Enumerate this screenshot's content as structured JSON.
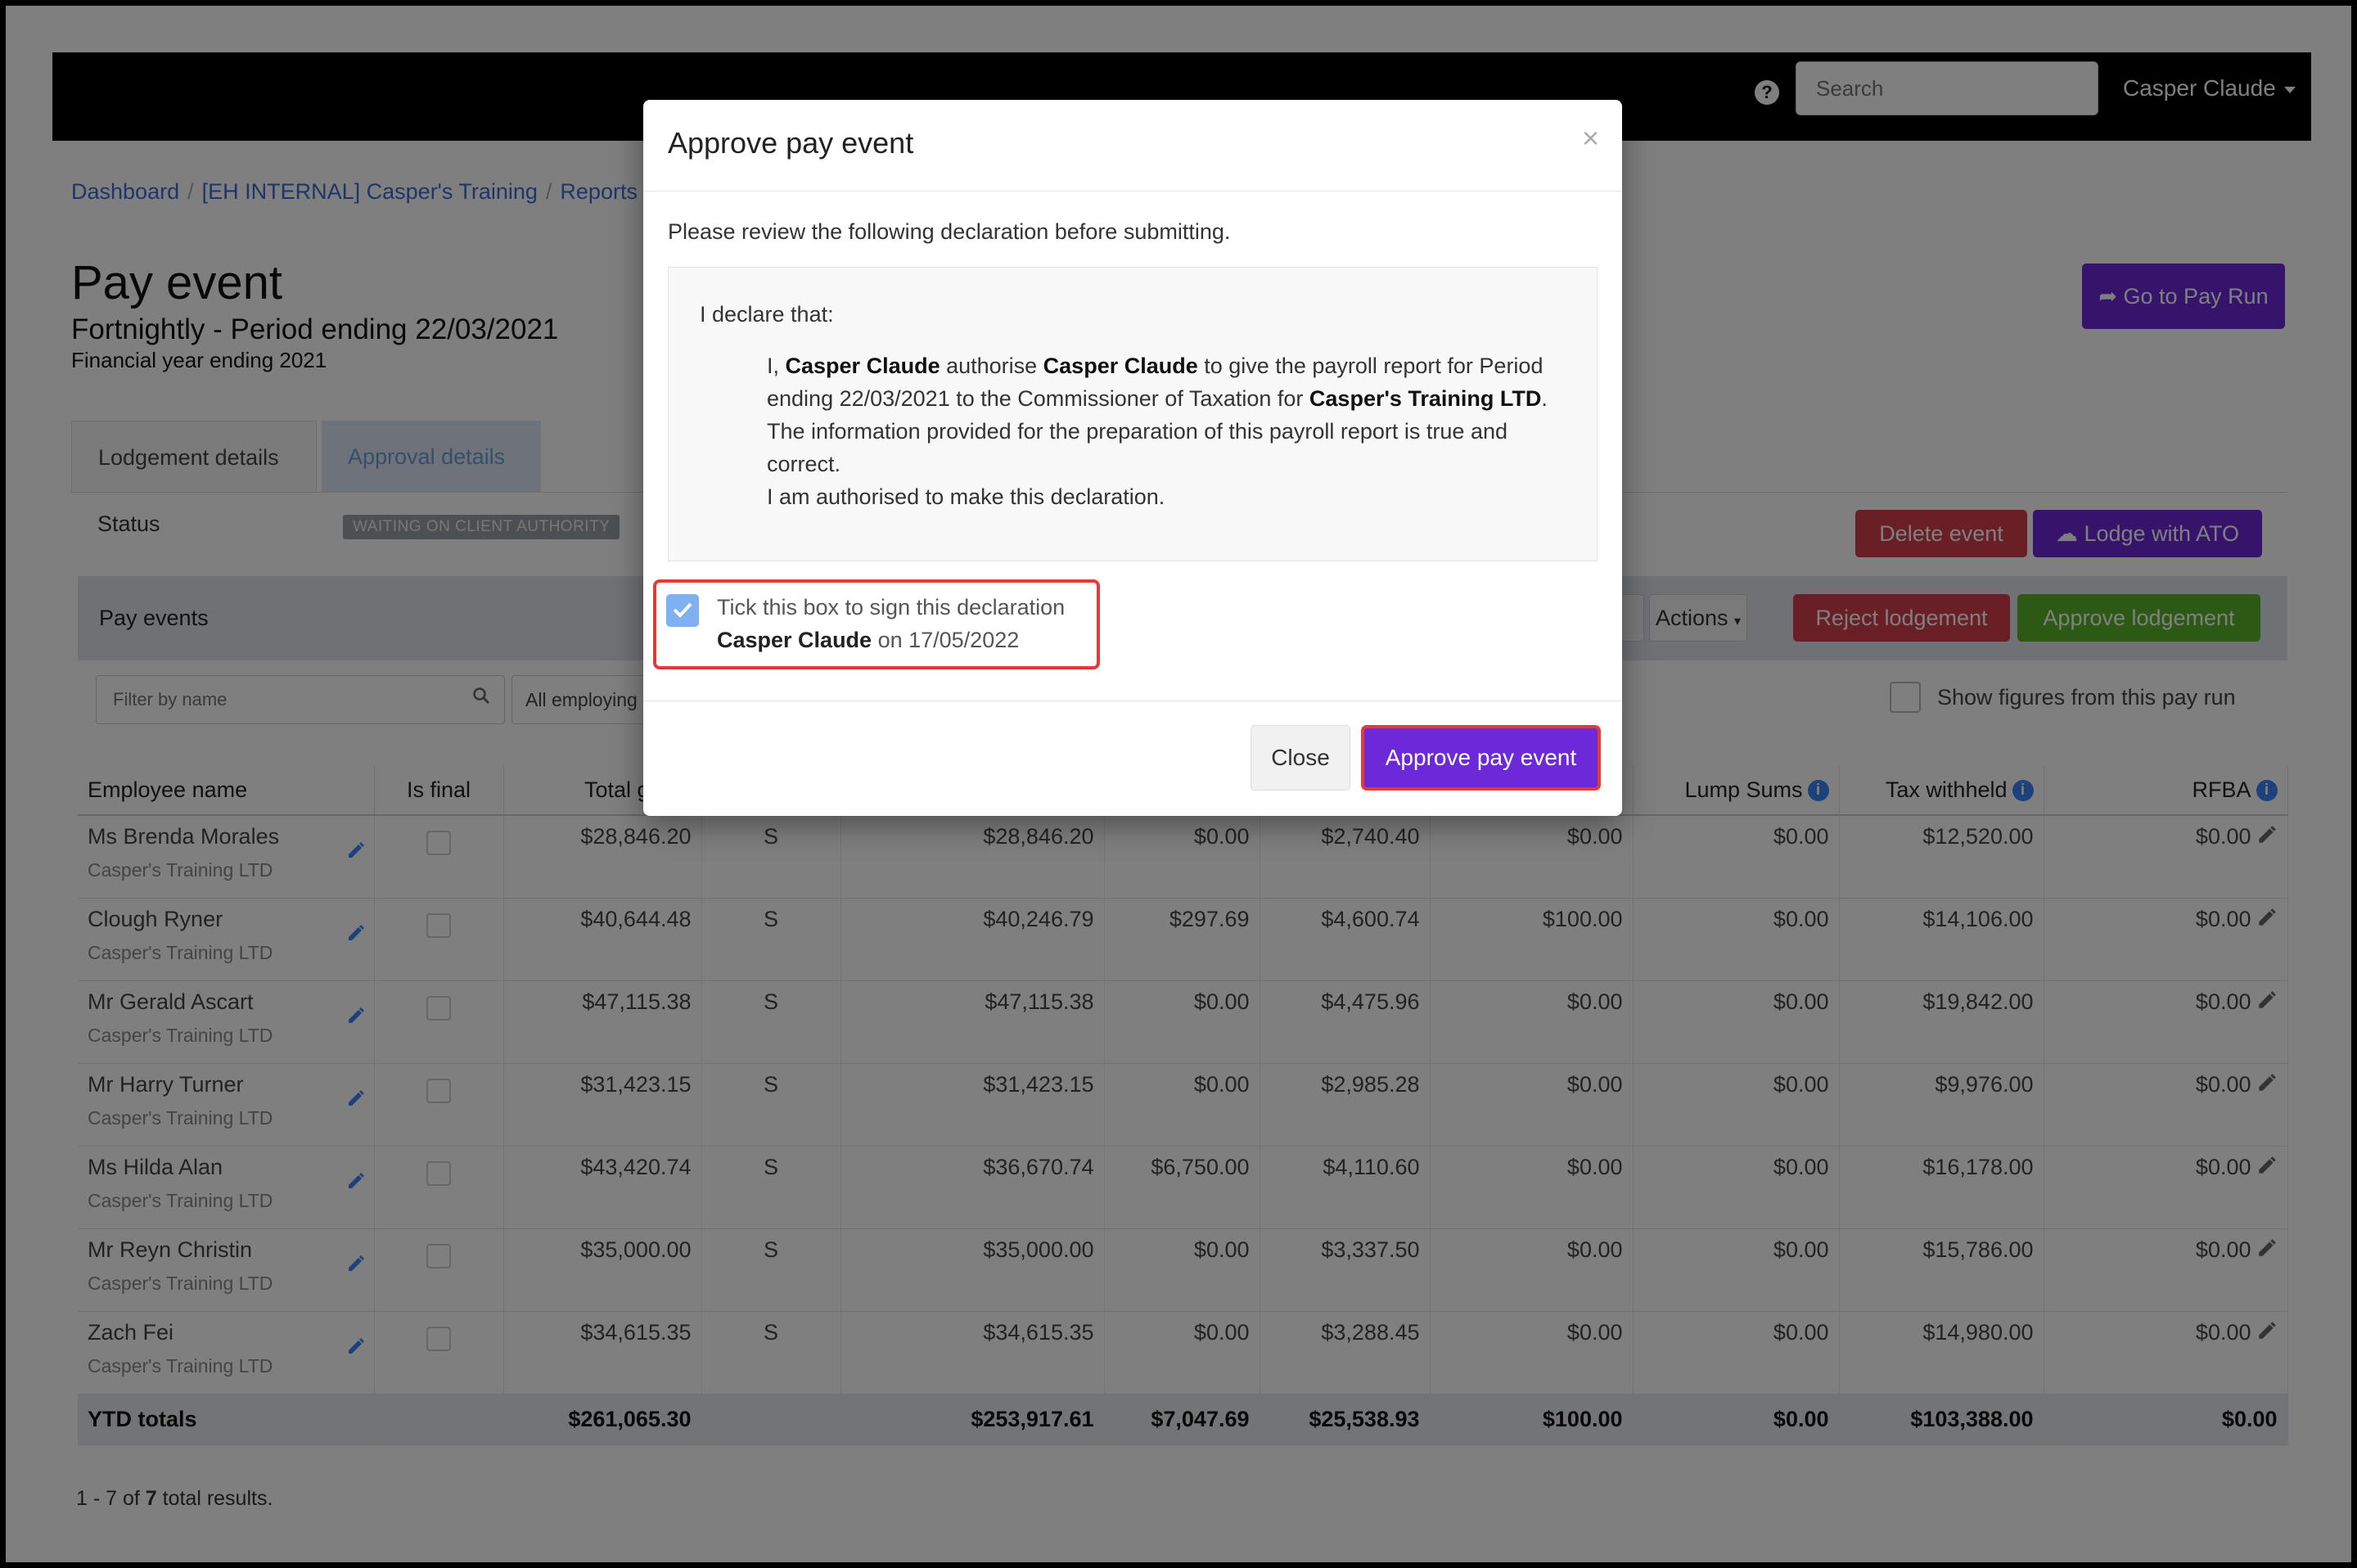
{
  "navbar": {
    "help_glyph": "?",
    "search_placeholder": "Search",
    "user_name": "Casper Claude"
  },
  "breadcrumb": [
    "Dashboard",
    "[EH INTERNAL] Casper's Training",
    "Reports"
  ],
  "header": {
    "title": "Pay event",
    "subtitle": "Fortnightly - Period ending 22/03/2021",
    "financial_year": "Financial year ending 2021",
    "go_to_pay_run": "Go to Pay Run"
  },
  "tabs": [
    {
      "label": "Lodgement details",
      "active": true
    },
    {
      "label": "Approval details",
      "active": false
    }
  ],
  "status": {
    "label": "Status",
    "badge": "WAITING ON CLIENT AUTHORITY"
  },
  "actions_top": {
    "delete": "Delete event",
    "lodge": "Lodge with ATO"
  },
  "pay_events": {
    "title": "Pay events",
    "actions": "Actions",
    "reject": "Reject lodgement",
    "approve": "Approve lodgement",
    "filter_placeholder": "Filter by name",
    "employing_select": "All employing entities",
    "show_figures": "Show figures from this pay run"
  },
  "table": {
    "headers": [
      "Employee name",
      "Is final",
      "Total gross",
      "",
      "",
      "",
      "",
      "",
      "Lump Sums",
      "Tax withheld",
      "RFBA"
    ],
    "rows": [
      {
        "name": "Ms Brenda Morales",
        "company": "Casper's Training LTD",
        "gross": "$28,846.20",
        "code": "S",
        "c4": "$28,846.20",
        "c5": "$0.00",
        "c6": "$2,740.40",
        "c7": "$0.00",
        "lump": "$0.00",
        "tax": "$12,520.00",
        "rfba": "$0.00"
      },
      {
        "name": "Clough Ryner",
        "company": "Casper's Training LTD",
        "gross": "$40,644.48",
        "code": "S",
        "c4": "$40,246.79",
        "c5": "$297.69",
        "c6": "$4,600.74",
        "c7": "$100.00",
        "lump": "$0.00",
        "tax": "$14,106.00",
        "rfba": "$0.00"
      },
      {
        "name": "Mr Gerald Ascart",
        "company": "Casper's Training LTD",
        "gross": "$47,115.38",
        "code": "S",
        "c4": "$47,115.38",
        "c5": "$0.00",
        "c6": "$4,475.96",
        "c7": "$0.00",
        "lump": "$0.00",
        "tax": "$19,842.00",
        "rfba": "$0.00"
      },
      {
        "name": "Mr Harry Turner",
        "company": "Casper's Training LTD",
        "gross": "$31,423.15",
        "code": "S",
        "c4": "$31,423.15",
        "c5": "$0.00",
        "c6": "$2,985.28",
        "c7": "$0.00",
        "lump": "$0.00",
        "tax": "$9,976.00",
        "rfba": "$0.00"
      },
      {
        "name": "Ms Hilda Alan",
        "company": "Casper's Training LTD",
        "gross": "$43,420.74",
        "code": "S",
        "c4": "$36,670.74",
        "c5": "$6,750.00",
        "c6": "$4,110.60",
        "c7": "$0.00",
        "lump": "$0.00",
        "tax": "$16,178.00",
        "rfba": "$0.00"
      },
      {
        "name": "Mr Reyn Christin",
        "company": "Casper's Training LTD",
        "gross": "$35,000.00",
        "code": "S",
        "c4": "$35,000.00",
        "c5": "$0.00",
        "c6": "$3,337.50",
        "c7": "$0.00",
        "lump": "$0.00",
        "tax": "$15,786.00",
        "rfba": "$0.00"
      },
      {
        "name": "Zach Fei",
        "company": "Casper's Training LTD",
        "gross": "$34,615.35",
        "code": "S",
        "c4": "$34,615.35",
        "c5": "$0.00",
        "c6": "$3,288.45",
        "c7": "$0.00",
        "lump": "$0.00",
        "tax": "$14,980.00",
        "rfba": "$0.00"
      }
    ],
    "totals": {
      "label": "YTD totals",
      "gross": "$261,065.30",
      "c4": "$253,917.61",
      "c5": "$7,047.69",
      "c6": "$25,538.93",
      "c7": "$100.00",
      "lump": "$0.00",
      "tax": "$103,388.00",
      "rfba": "$0.00"
    },
    "results": {
      "prefix": "1 - 7 of ",
      "count": "7",
      "suffix": " total results."
    }
  },
  "modal": {
    "title": "Approve pay event",
    "close_glyph": "×",
    "intro": "Please review the following declaration before submitting.",
    "declaration_head": "I declare that:",
    "decl": {
      "p1": "I, ",
      "name1": "Casper Claude",
      "p2": " authorise ",
      "name2": "Casper Claude",
      "p3": " to give the payroll report for Period ending 22/03/2021 to the Commissioner of Taxation for ",
      "company": "Casper's Training LTD",
      "p4": ". The information provided for the preparation of this payroll report is true and correct.",
      "line2": "I am authorised to make this declaration."
    },
    "sign_label": "Tick this box to sign this declaration",
    "sign_name": "Casper Claude",
    "sign_date": " on 17/05/2022",
    "sign_checked": true,
    "close_button": "Close",
    "approve_button": "Approve pay event"
  }
}
